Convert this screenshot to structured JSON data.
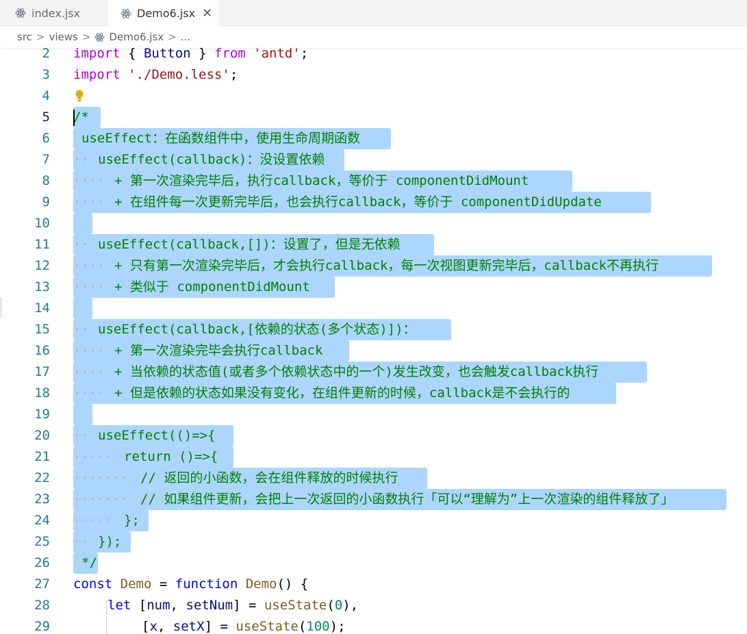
{
  "tabs": [
    {
      "label": "index.jsx",
      "icon": "react-icon",
      "active": false
    },
    {
      "label": "Demo6.jsx",
      "icon": "react-icon",
      "active": true,
      "close": "✕"
    }
  ],
  "breadcrumb": {
    "items": [
      "src",
      "views",
      "Demo6.jsx",
      "..."
    ],
    "separator": ">"
  },
  "colors": {
    "selection": "#add6ff",
    "comment": "#008000",
    "line_number": "#237893",
    "keyword": "#af00db"
  },
  "lines": [
    {
      "n": "2"
    },
    {
      "n": "3"
    },
    {
      "n": "4"
    },
    {
      "n": "5"
    },
    {
      "n": "6"
    },
    {
      "n": "7"
    },
    {
      "n": "8"
    },
    {
      "n": "9"
    },
    {
      "n": "10"
    },
    {
      "n": "11"
    },
    {
      "n": "12"
    },
    {
      "n": "13"
    },
    {
      "n": "14"
    },
    {
      "n": "15"
    },
    {
      "n": "16"
    },
    {
      "n": "17"
    },
    {
      "n": "18"
    },
    {
      "n": "19"
    },
    {
      "n": "20"
    },
    {
      "n": "21"
    },
    {
      "n": "22"
    },
    {
      "n": "23"
    },
    {
      "n": "24"
    },
    {
      "n": "25"
    },
    {
      "n": "26"
    },
    {
      "n": "27"
    },
    {
      "n": "28"
    },
    {
      "n": "29"
    }
  ],
  "code": {
    "l2": {
      "import": "import",
      "a": " { ",
      "button": "Button",
      "b": " } ",
      "from": "from",
      "c": " ",
      "str": "'antd'",
      "d": ";"
    },
    "l3": {
      "import": "import",
      "c": " ",
      "str": "'./Demo.less'",
      "d": ";"
    },
    "l5": "/*",
    "l6": "useEffect：在函数组件中，使用生命周期函数",
    "l7": "useEffect(callback)：没设置依赖",
    "l8": "+ 第一次渲染完毕后，执行callback，等价于 componentDidMount",
    "l9": "+ 在组件每一次更新完毕后，也会执行callback，等价于 componentDidUpdate",
    "l11": "useEffect(callback,[])：设置了，但是无依赖",
    "l12": "+ 只有第一次渲染完毕后，才会执行callback，每一次视图更新完毕后，callback不再执行",
    "l13": "+ 类似于 componentDidMount",
    "l15": "useEffect(callback,[依赖的状态(多个状态)])：",
    "l16": "+ 第一次渲染完毕会执行callback",
    "l17": "+ 当依赖的状态值(或者多个依赖状态中的一个)发生改变，也会触发callback执行",
    "l18": "+ 但是依赖的状态如果没有变化，在组件更新的时候，callback是不会执行的",
    "l20": "useEffect(()=>{",
    "l21": "return ()=>{",
    "l22": "// 返回的小函数，会在组件释放的时候执行",
    "l23": "// 如果组件更新，会把上一次返回的小函数执行「可以“理解为”上一次渲染的组件释放了」",
    "l24": "};",
    "l25": "});",
    "l26": "*/",
    "l27": {
      "const": "const",
      "a": " ",
      "name": "Demo",
      "b": " = ",
      "function": "function",
      "c": " ",
      "fn": "Demo",
      "d": "() {"
    },
    "l28": {
      "let": "let",
      "a": " [",
      "num": "num",
      "b": ", ",
      "setNum": "setNum",
      "c": "] = ",
      "useState": "useState",
      "d": "(",
      "v": "0",
      "e": "),"
    },
    "l29": {
      "a": "[",
      "x": "x",
      "b": ", ",
      "setX": "setX",
      "c": "] = ",
      "useState": "useState",
      "d": "(",
      "v": "100",
      "e": ");"
    }
  }
}
